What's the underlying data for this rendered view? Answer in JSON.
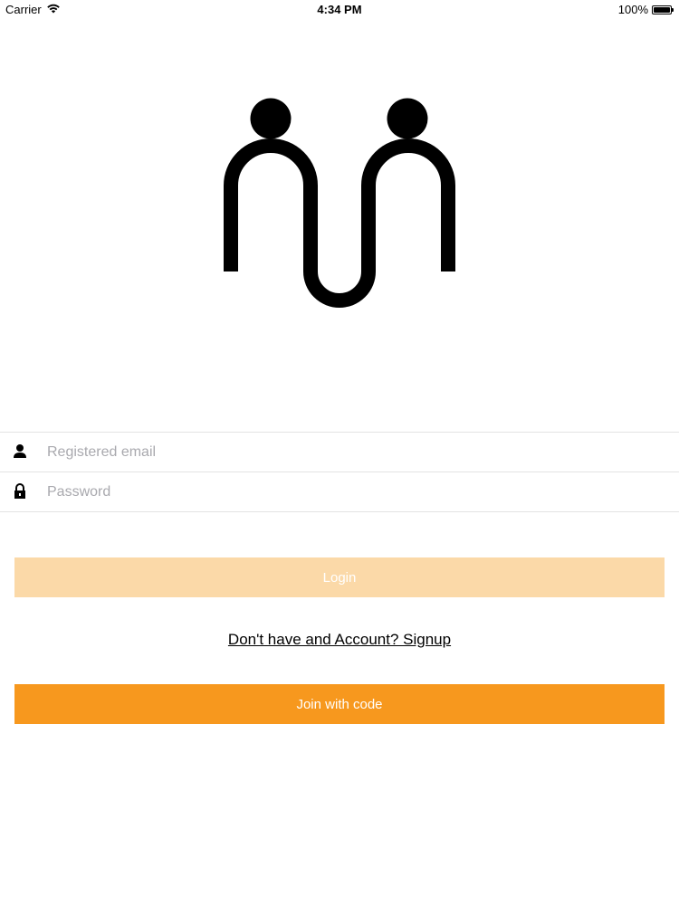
{
  "status_bar": {
    "carrier": "Carrier",
    "time": "4:34 PM",
    "battery": "100%",
    "battery_level": 1.0
  },
  "logo": {
    "icon": "two-people-logo-icon",
    "color": "#000000"
  },
  "form": {
    "email": {
      "icon": "person-icon",
      "placeholder": "Registered email",
      "value": ""
    },
    "password": {
      "icon": "lock-icon",
      "placeholder": "Password",
      "value": ""
    }
  },
  "buttons": {
    "login_label": "Login",
    "login_color": "#fbd9a8",
    "signup_link": "Don't have and Account? Signup",
    "join_label": "Join with code",
    "join_color": "#f7981e"
  }
}
